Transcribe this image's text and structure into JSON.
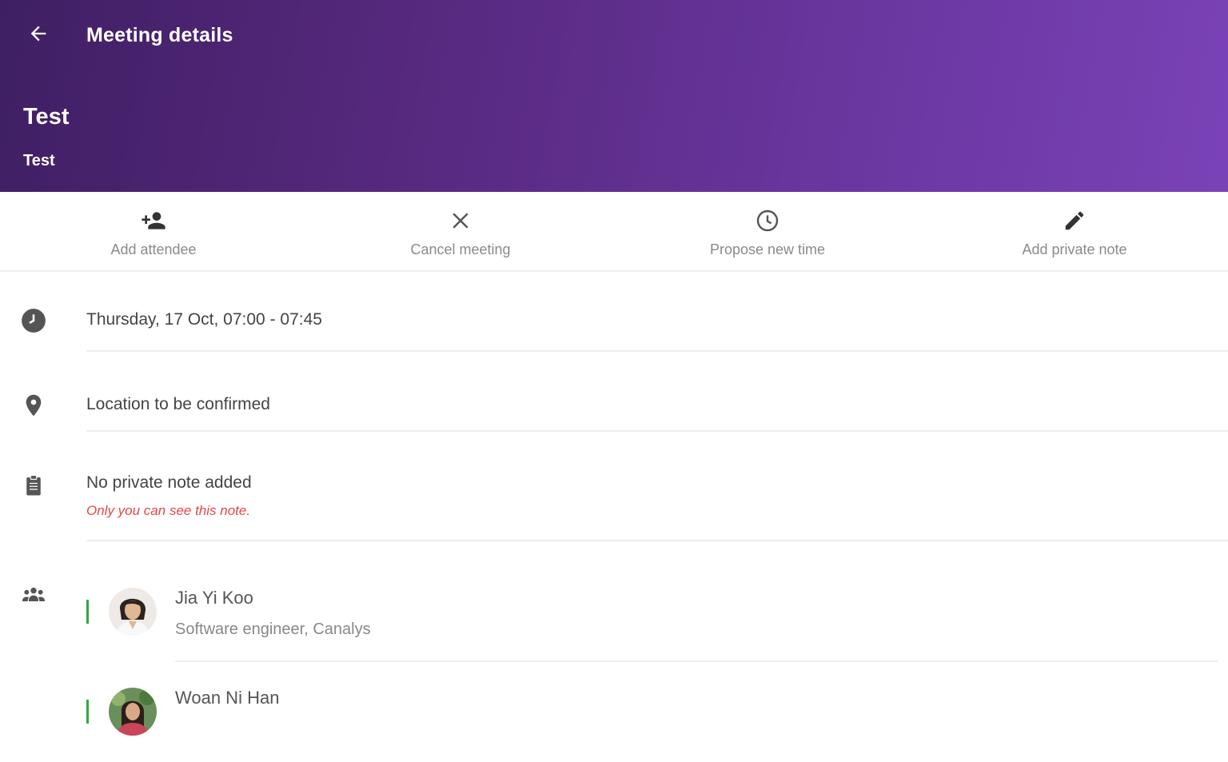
{
  "header": {
    "title": "Meeting details",
    "back_icon": "arrow-left-icon",
    "gradient_start": "#3f1f63",
    "gradient_end": "#7a42b7"
  },
  "meeting": {
    "title": "Test",
    "subtitle": "Test"
  },
  "toolbar": {
    "items": [
      {
        "label": "Add attendee",
        "icon": "add-person-icon"
      },
      {
        "label": "Cancel meeting",
        "icon": "close-icon"
      },
      {
        "label": "Propose new time",
        "icon": "clock-icon"
      },
      {
        "label": "Add private note",
        "icon": "pencil-icon"
      }
    ]
  },
  "details": {
    "datetime": "Thursday, 17 Oct, 07:00 - 07:45",
    "location": "Location to be confirmed",
    "note": "No private note added",
    "note_hint": "Only you can see this note."
  },
  "attendees": [
    {
      "name": "Jia Yi Koo",
      "role": "Software engineer, Canalys",
      "status_color": "#2eaa3f"
    },
    {
      "name": "Woan Ni Han",
      "role": "",
      "status_color": "#2eaa3f"
    }
  ],
  "colors": {
    "accent": "#5a2b84",
    "hint": "#e04848",
    "status_accepted": "#2eaa3f"
  }
}
